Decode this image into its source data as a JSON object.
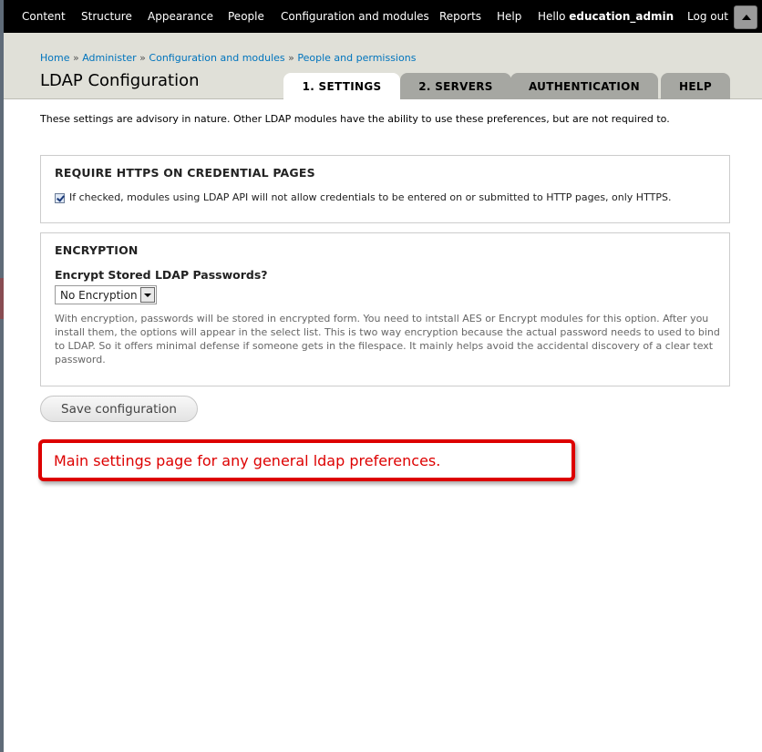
{
  "toolbar": {
    "items": [
      "Content",
      "Structure",
      "Appearance",
      "People",
      "Configuration and modules",
      "Reports",
      "Help"
    ],
    "greeting": "Hello",
    "username": "education_admin",
    "logout": "Log out"
  },
  "breadcrumb": {
    "items": [
      "Home",
      "Administer",
      "Configuration and modules",
      "People and permissions"
    ],
    "separator": "»"
  },
  "page_title": "LDAP Configuration",
  "tabs": [
    {
      "label": "1. SETTINGS",
      "active": true
    },
    {
      "label": "2. SERVERS",
      "active": false
    },
    {
      "label": "AUTHENTICATION",
      "active": false
    },
    {
      "label": "HELP",
      "active": false
    }
  ],
  "intro": "These settings are advisory in nature. Other LDAP modules have the ability to use these preferences, but are not required to.",
  "https": {
    "legend": "REQUIRE HTTPS ON CREDENTIAL PAGES",
    "checked": true,
    "label": "If checked, modules using LDAP API will not allow credentials to be entered on or submitted to HTTP pages, only HTTPS."
  },
  "encryption": {
    "legend": "ENCRYPTION",
    "field_label": "Encrypt Stored LDAP Passwords?",
    "selected": "No Encryption",
    "description": "With encryption, passwords will be stored in encrypted form. You need to intstall AES or Encrypt modules for this option. After you install them, the options will appear in the select list. This is two way encryption because the actual password needs to used to bind to LDAP. So it offers minimal defense if someone gets in the filespace. It mainly helps avoid the accidental discovery of a clear text password."
  },
  "save_label": "Save configuration",
  "callout": "Main settings page for any general ldap preferences.",
  "colors": {
    "toolbar_bg": "#000000",
    "header_bg": "#e0e0d8",
    "link": "#0074bd",
    "callout_border": "#dd0000"
  }
}
